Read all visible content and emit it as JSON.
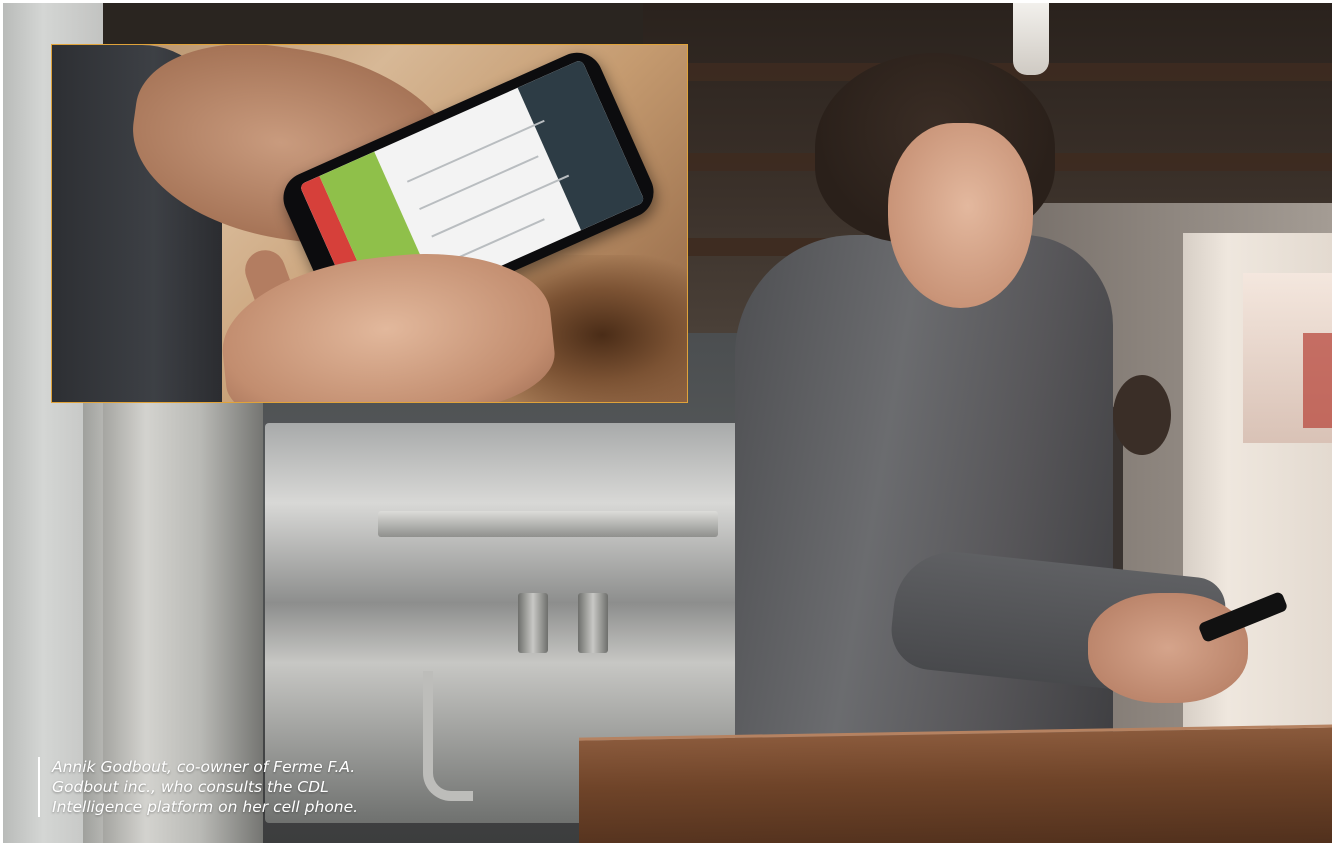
{
  "image": {
    "caption_lines": [
      "Annik Godbout, co-owner of Ferme F.A.",
      "Godbout inc., who consults the CDL",
      "Intelligence platform on her cell phone."
    ]
  },
  "colors": {
    "inset_border": "#e0a33a",
    "caption_text": "#ffffff",
    "app_red": "#d6403a",
    "app_green": "#8fc04a",
    "app_header": "#2d3c45"
  }
}
